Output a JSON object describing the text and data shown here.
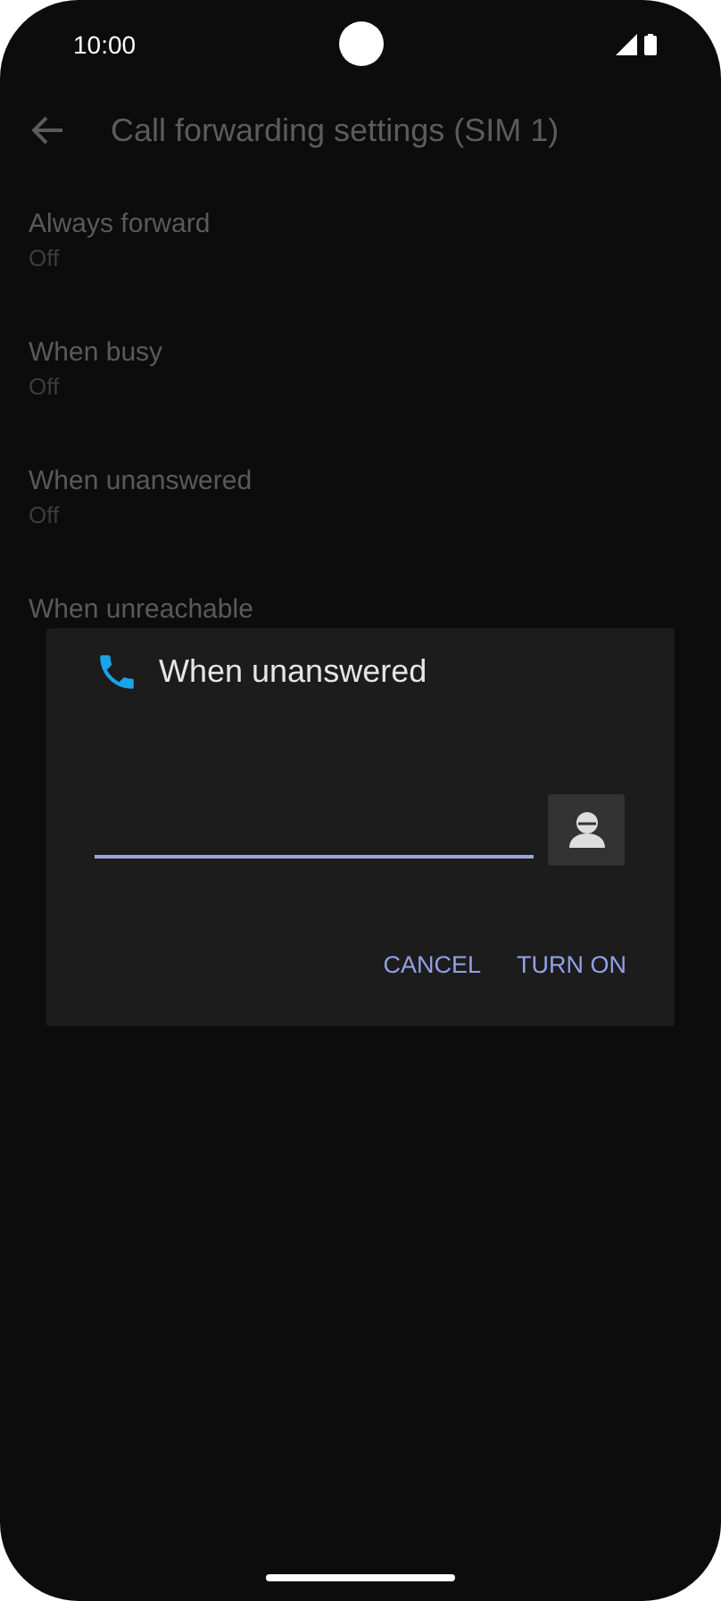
{
  "status_bar": {
    "time": "10:00"
  },
  "app_bar": {
    "title": "Call forwarding settings (SIM 1)"
  },
  "settings": [
    {
      "title": "Always forward",
      "subtitle": "Off"
    },
    {
      "title": "When busy",
      "subtitle": "Off"
    },
    {
      "title": "When unanswered",
      "subtitle": "Off"
    },
    {
      "title": "When unreachable"
    }
  ],
  "dialog": {
    "title": "When unanswered",
    "buttons": [
      "CANCEL",
      "TURN ON"
    ]
  }
}
